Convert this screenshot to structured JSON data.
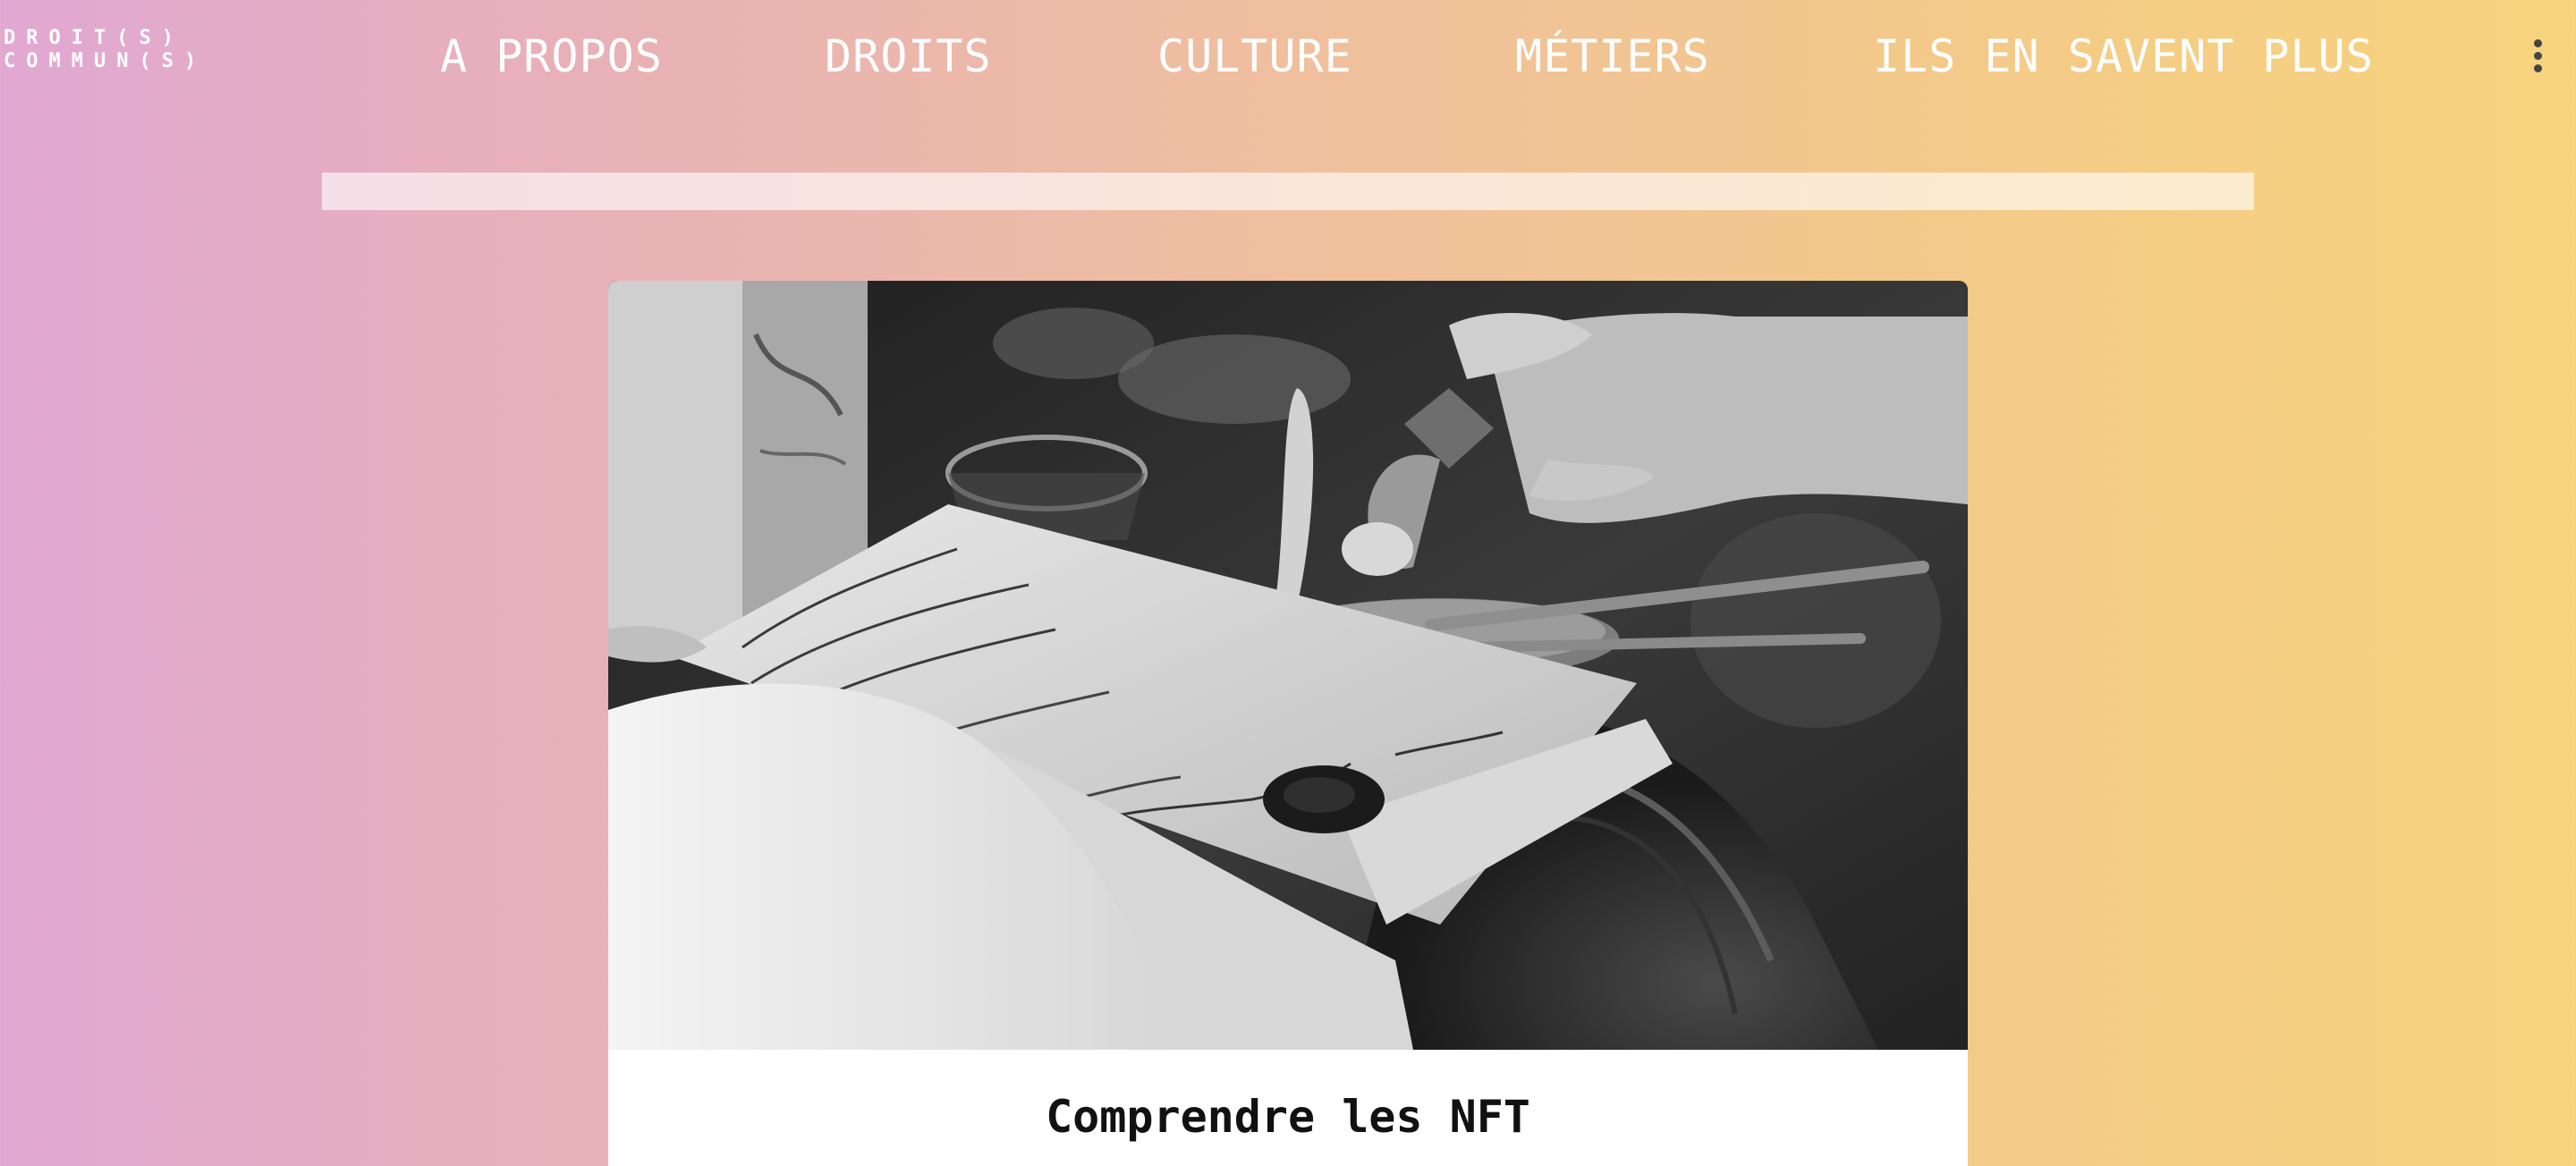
{
  "logo": {
    "line1": "DROIT(S)",
    "line2": "COMMUN(S)"
  },
  "nav": {
    "items": [
      {
        "label": "A PROPOS"
      },
      {
        "label": "DROITS"
      },
      {
        "label": "CULTURE"
      },
      {
        "label": "MÉTIERS"
      },
      {
        "label": "ILS EN SAVENT PLUS"
      }
    ],
    "more_icon": "more-vertical-icon"
  },
  "search": {
    "placeholder": ""
  },
  "card": {
    "image_icon": "wax-seal-photo",
    "title": "Comprendre les NFT"
  },
  "colors": {
    "gradient_left": "#e1a8d3",
    "gradient_right": "#f7d47d",
    "nav_text": "#ffffff",
    "card_background": "#ffffff"
  }
}
